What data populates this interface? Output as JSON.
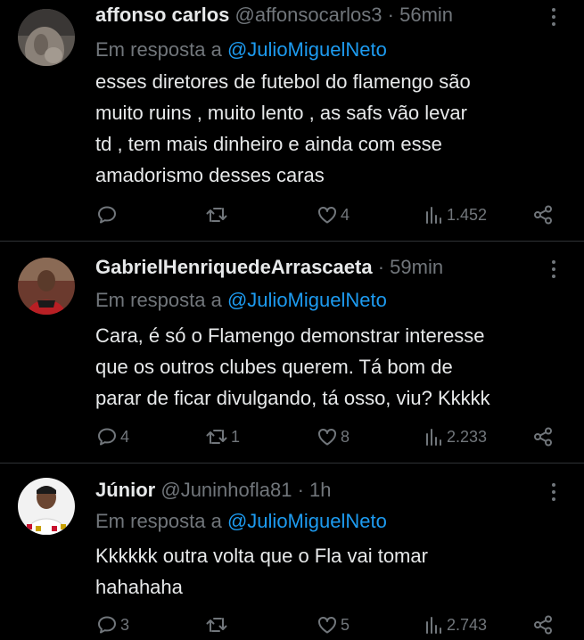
{
  "tweets": [
    {
      "name": "affonso carlos",
      "handle": "@affonsocarlos3",
      "dot": "·",
      "time": "56min",
      "reply_prefix": "Em resposta a",
      "reply_to": "@JulioMiguelNeto",
      "text": "esses diretores de futebol do flamengo são\nmuito ruins , muito lento , as safs vão levar\ntd , tem mais dinheiro e ainda com esse\namadorismo desses caras",
      "replies": "",
      "retweets": "",
      "likes": "4",
      "views": "1.452"
    },
    {
      "name": "GabrielHenriquedeArrascaeta",
      "handle": "",
      "dot": "·",
      "time": "59min",
      "reply_prefix": "Em resposta a",
      "reply_to": "@JulioMiguelNeto",
      "text": "Cara, é só o Flamengo demonstrar interesse\nque os outros clubes querem. Tá bom de\nparar de ficar divulgando, tá osso, viu? Kkkkk",
      "replies": "4",
      "retweets": "1",
      "likes": "8",
      "views": "2.233"
    },
    {
      "name": "Júnior",
      "handle": "@Juninhofla81",
      "dot": "·",
      "time": "1h",
      "reply_prefix": "Em resposta a",
      "reply_to": "@JulioMiguelNeto",
      "text": "Kkkkkk outra volta que o Fla vai tomar\nhahahaha",
      "replies": "3",
      "retweets": "",
      "likes": "5",
      "views": "2.743"
    }
  ],
  "icons": {
    "reply": "reply-icon",
    "retweet": "retweet-icon",
    "like": "heart-icon",
    "views": "views-chart-icon",
    "share": "share-icon",
    "more": "more-options-icon"
  },
  "colors": {
    "background": "#000000",
    "text": "#e7e9ea",
    "muted": "#71767b",
    "mention": "#1d9bf0",
    "separator": "#2f3336"
  }
}
